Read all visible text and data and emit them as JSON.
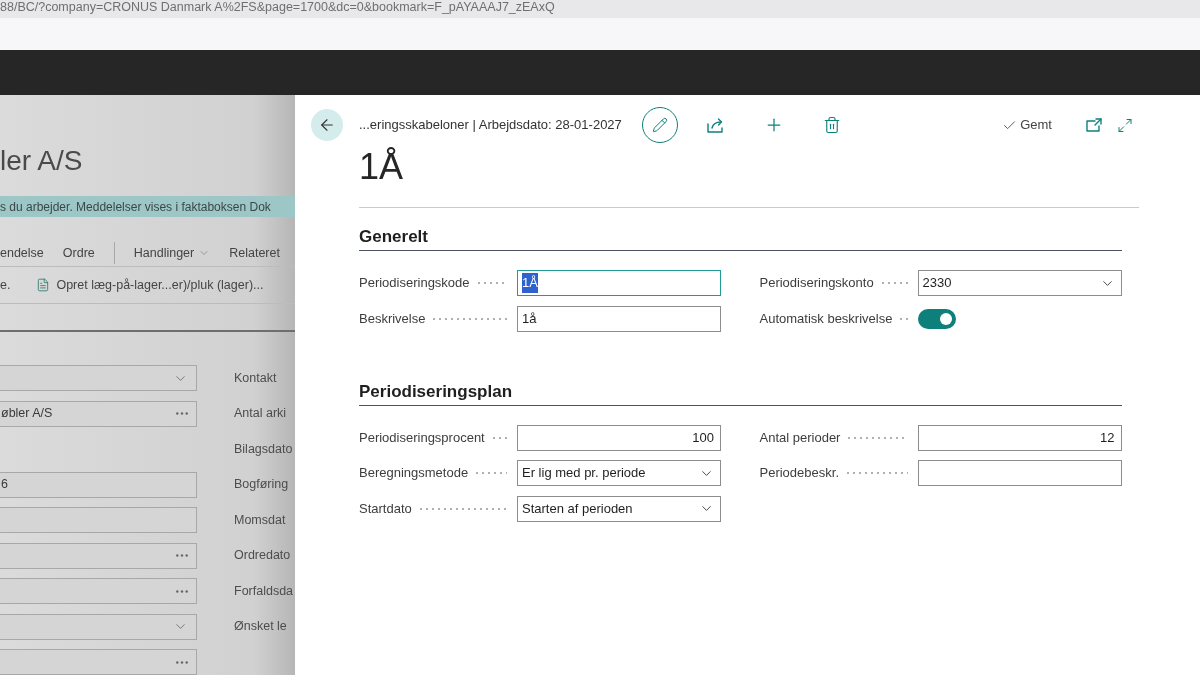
{
  "browser": {
    "url": "88/BC/?company=CRONUS Danmark A%2FS&page=1700&dc=0&bookmark=F_pAYAAAJ7_zEAxQ"
  },
  "background_page": {
    "title": "ler A/S",
    "notification": "s du arbejder. Meddelelser vises i faktaboksen Dok",
    "actions": [
      {
        "label": "endelse",
        "kind": "plain"
      },
      {
        "label": "Ordre",
        "kind": "plain"
      },
      {
        "kind": "divider"
      },
      {
        "label": "Handlinger",
        "kind": "menu"
      },
      {
        "label": "Relateret",
        "kind": "plain"
      }
    ],
    "commands": [
      {
        "label": "e.",
        "kind": "plain"
      },
      {
        "label": "Opret læg-på-lager...er)/pluk (lager)...",
        "kind": "document"
      }
    ],
    "rows": [
      {
        "field": {
          "kind": "select"
        },
        "label": "Kontakt"
      },
      {
        "field": {
          "kind": "lookup",
          "value": "øbler A/S"
        },
        "label": "Antal arki"
      },
      {
        "label": "Bilagsdato"
      },
      {
        "field": {
          "kind": "text",
          "value": "6"
        },
        "label": "Bogføring"
      },
      {
        "field": {
          "kind": "text"
        },
        "label": "Momsdat"
      },
      {
        "field": {
          "kind": "lookup"
        },
        "label": "Ordredato"
      },
      {
        "field": {
          "kind": "lookup"
        },
        "label": "Forfaldsda"
      },
      {
        "field": {
          "kind": "select"
        },
        "label": "Ønsket le"
      },
      {
        "field": {
          "kind": "lookup"
        }
      }
    ]
  },
  "card": {
    "breadcrumb": "...eringsskabeloner | Arbejdsdato: 28-01-2027",
    "status": "Gemt",
    "title": "1Å",
    "sections": [
      {
        "title": "Generelt",
        "columns": [
          [
            {
              "label": "Periodiseringskode",
              "kind": "text",
              "value": "1Å",
              "focused": true
            },
            {
              "label": "Beskrivelse",
              "kind": "text",
              "value": "1å",
              "focused": false
            }
          ],
          [
            {
              "label": "Periodiseringskonto",
              "kind": "select",
              "value": "2330",
              "focused": false
            },
            {
              "label": "Automatisk beskrivelse",
              "kind": "toggle",
              "on": true
            }
          ]
        ]
      },
      {
        "title": "Periodiseringsplan",
        "columns": [
          [
            {
              "label": "Periodiseringsprocent",
              "kind": "number",
              "value": "100",
              "focused": false
            },
            {
              "label": "Beregningsmetode",
              "kind": "select",
              "value": "Er lig med pr. periode",
              "focused": false
            },
            {
              "label": "Startdato",
              "kind": "select",
              "value": "Starten af perioden",
              "focused": false
            }
          ],
          [
            {
              "label": "Antal perioder",
              "kind": "number",
              "value": "12",
              "focused": false
            },
            {
              "label": "Periodebeskr.",
              "kind": "text",
              "focused": false
            }
          ]
        ]
      }
    ]
  }
}
